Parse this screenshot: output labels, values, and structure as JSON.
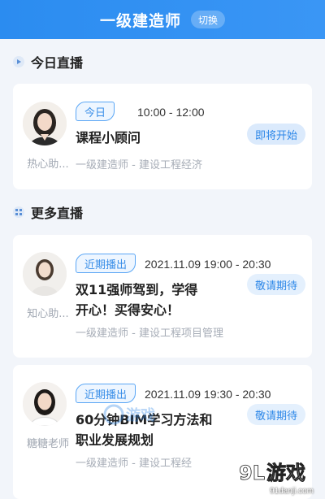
{
  "header": {
    "title": "一级建造师",
    "switch_label": "切换"
  },
  "today": {
    "section_title": "今日直播",
    "card": {
      "tag": "今日",
      "time": "10:00 - 12:00",
      "title": "课程小顾问",
      "subtitle": "一级建造师 - 建设工程经济",
      "host": "热心助...",
      "button": "即将开始"
    }
  },
  "more": {
    "section_title": "更多直播",
    "cards": [
      {
        "tag": "近期播出",
        "time": "2021.11.09 19:00 - 20:30",
        "title_line1": "双11强师驾到，学得",
        "title_line2": "开心！买得安心！",
        "subtitle": "一级建造师 - 建设工程项目管理",
        "host": "知心助...",
        "button": "敬请期待"
      },
      {
        "tag": "近期播出",
        "time": "2021.11.09 19:30 - 20:30",
        "title_line1": "60分钟BIM学习方法和",
        "title_line2": "职业发展规划",
        "subtitle": "一级建造师 - 建设工程经",
        "host": "糖糖老师",
        "button": "敬请期待"
      }
    ]
  },
  "watermark": {
    "logo_num": "9L",
    "logo_text": "游戏",
    "url": "91danji.com",
    "center_text": "游戏"
  },
  "colors": {
    "header_bg": "#2b8cf0",
    "accent": "#3b8fe8",
    "button_bg": "#e4f0fd",
    "page_bg": "#f2f5fa"
  }
}
